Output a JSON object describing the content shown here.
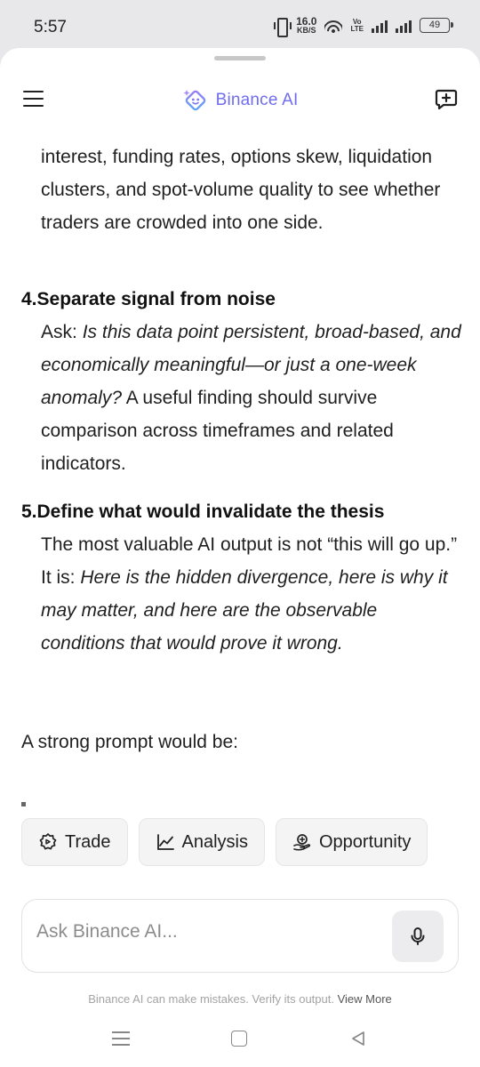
{
  "status_bar": {
    "time": "5:57",
    "net_speed_value": "16.0",
    "net_speed_unit": "KB/S",
    "volte_top": "Vo",
    "volte_bottom": "LTE",
    "battery": "49"
  },
  "header": {
    "brand_name": "Binance AI"
  },
  "content": {
    "top_paragraph": "interest, funding rates, options skew, liquidation clusters, and spot-volume quality to see whether traders are crowded into one side.",
    "item4": {
      "number": "4.",
      "title": "Separate signal from noise",
      "prefix": "Ask: ",
      "italic": "Is this data point persistent, broad-based, and economically meaningful—or just a one-week anomaly?",
      "suffix": " A useful finding should survive comparison across timeframes and related indicators."
    },
    "item5": {
      "number": "5.",
      "title": "Define what would invalidate the thesis",
      "prefix": "The most valuable AI output is not “this will go up.” It is: ",
      "italic": "Here is the hidden divergence, here is why it may matter, and here are the observable conditions that would prove it wrong."
    },
    "closing": "A strong prompt would be:"
  },
  "chips": [
    {
      "label": "Trade",
      "icon": "trade-icon"
    },
    {
      "label": "Analysis",
      "icon": "chart-line-icon"
    },
    {
      "label": "Opportunity",
      "icon": "opportunity-icon"
    }
  ],
  "input": {
    "placeholder": "Ask Binance AI..."
  },
  "disclaimer": {
    "text": "Binance AI can make mistakes. Verify its output.",
    "link": "View More"
  },
  "colors": {
    "brand": "#6f6cf0",
    "text": "#1f1f1f",
    "chip_bg": "#f4f4f5"
  }
}
